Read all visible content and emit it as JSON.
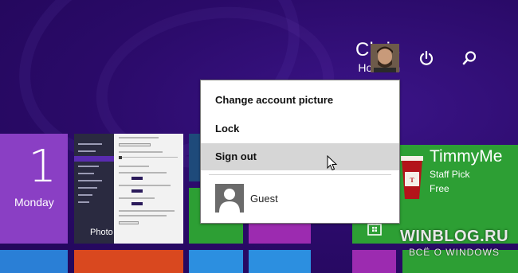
{
  "user": {
    "first_name": "Chris",
    "last_name": "Hoffman"
  },
  "top_buttons": {
    "power_icon": "power-icon",
    "search_icon": "search-icon"
  },
  "account_menu": {
    "items": [
      {
        "label": "Change account picture",
        "hovered": false
      },
      {
        "label": "Lock",
        "hovered": false
      },
      {
        "label": "Sign out",
        "hovered": true
      }
    ],
    "other_accounts": [
      {
        "name": "Guest",
        "icon": "person-silhouette-icon"
      }
    ]
  },
  "tiles": {
    "calendar": {
      "day_number": "1",
      "day_name": "Monday"
    },
    "photos": {
      "label": "Photo"
    },
    "store_app": {
      "title": "TimmyMe",
      "subtitle": "Staff Pick",
      "price": "Free",
      "icon": "coffee-cup-icon"
    },
    "green_small_icon": "store-bag-icon"
  },
  "watermark": {
    "title": "WINBLOG.RU",
    "subtitle": "ВСЁ О WINDOWS"
  },
  "colors": {
    "background": "#2a0a68",
    "calendar_tile": "#8a3fc4",
    "store_tile": "#2d9f34",
    "menu_hover": "#d6d6d6"
  }
}
